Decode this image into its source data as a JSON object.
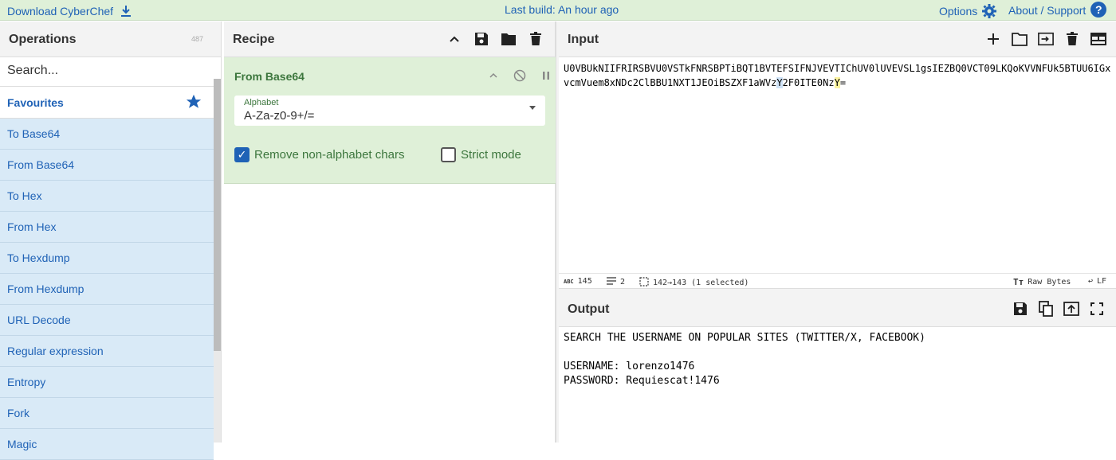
{
  "topbar": {
    "download_label": "Download CyberChef",
    "build_label": "Last build: An hour ago",
    "options_label": "Options",
    "about_label": "About / Support"
  },
  "operations": {
    "title": "Operations",
    "count": "487",
    "search_placeholder": "Search...",
    "favourites_label": "Favourites",
    "items": [
      {
        "label": "To Base64"
      },
      {
        "label": "From Base64"
      },
      {
        "label": "To Hex"
      },
      {
        "label": "From Hex"
      },
      {
        "label": "To Hexdump"
      },
      {
        "label": "From Hexdump"
      },
      {
        "label": "URL Decode"
      },
      {
        "label": "Regular expression"
      },
      {
        "label": "Entropy"
      },
      {
        "label": "Fork"
      },
      {
        "label": "Magic"
      }
    ]
  },
  "recipe": {
    "title": "Recipe",
    "operation": {
      "name": "From Base64",
      "alphabet_label": "Alphabet",
      "alphabet_value": "A-Za-z0-9+/=",
      "remove_nonalpha_label": "Remove non-alphabet chars",
      "remove_nonalpha_checked": true,
      "strict_mode_label": "Strict mode",
      "strict_mode_checked": false
    }
  },
  "input": {
    "title": "Input",
    "text_part1": "U0VBUkNIIFRIRSBVU0VSTkFNRSBPTiBQT1BVTEFSIFNJVEVTIChUV0lUVEVSL1gsIEZBQ0VCT09LKQoKVVNFUk5BTUU6IGxvcmVuem8xNDc2ClBBU1NXT1JEOiBSZXF1aWVz",
    "text_hl1": "Y",
    "text_part2": "2F0ITE0Nz",
    "text_hl2": "Y",
    "text_part3": "=",
    "status": {
      "length": "145",
      "lines": "2",
      "selection": "142→143 (1 selected)",
      "raw_bytes": "Raw Bytes",
      "eol": "LF"
    }
  },
  "output": {
    "title": "Output",
    "text": "SEARCH THE USERNAME ON POPULAR SITES (TWITTER/X, FACEBOOK)\n\nUSERNAME: lorenzo1476\nPASSWORD: Requiescat!1476"
  },
  "colors": {
    "accent": "#1f62b6",
    "recipe_op_bg": "#dff0d8",
    "recipe_op_text": "#3c763d",
    "op_item_bg": "#d9eaf7"
  }
}
